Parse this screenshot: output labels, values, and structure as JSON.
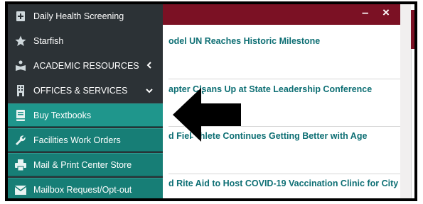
{
  "window": {
    "minimize_label": "–",
    "close_label": "×",
    "bar_color": "#7b1124"
  },
  "sidebar": {
    "items": [
      {
        "label": "Daily Health Screening",
        "icon": "clipboard-plus-icon"
      },
      {
        "label": "Starfish",
        "icon": "star-icon"
      },
      {
        "label": "ACADEMIC RESOURCES",
        "icon": "reader-icon",
        "chevron": "‹"
      },
      {
        "label": "OFFICES & SERVICES",
        "icon": "building-icon",
        "chevron": "⌄"
      },
      {
        "label": "Buy Textbooks",
        "icon": "book-icon"
      },
      {
        "label": "Facilities Work Orders",
        "icon": "wrench-icon"
      },
      {
        "label": "Mail & Print Center Store",
        "icon": "printer-icon"
      },
      {
        "label": "Mailbox Request/Opt-out",
        "icon": "mailbox-icon"
      }
    ],
    "colors": {
      "dark": "#2c3236",
      "teal": "#177e76",
      "active": "#1f968c"
    }
  },
  "news": {
    "items": [
      "odel UN Reaches Historic Milestone",
      "apter Clʂans Up at State Leadership Conference",
      "d Fiel̵  thlete Continues Getting Better with Age",
      "d Rite Aid to Host COVID-19 Vaccination Clinic for City"
    ],
    "text_color": "#0e6f74"
  },
  "annotation": {
    "arrow": "pointing-left-arrow"
  }
}
